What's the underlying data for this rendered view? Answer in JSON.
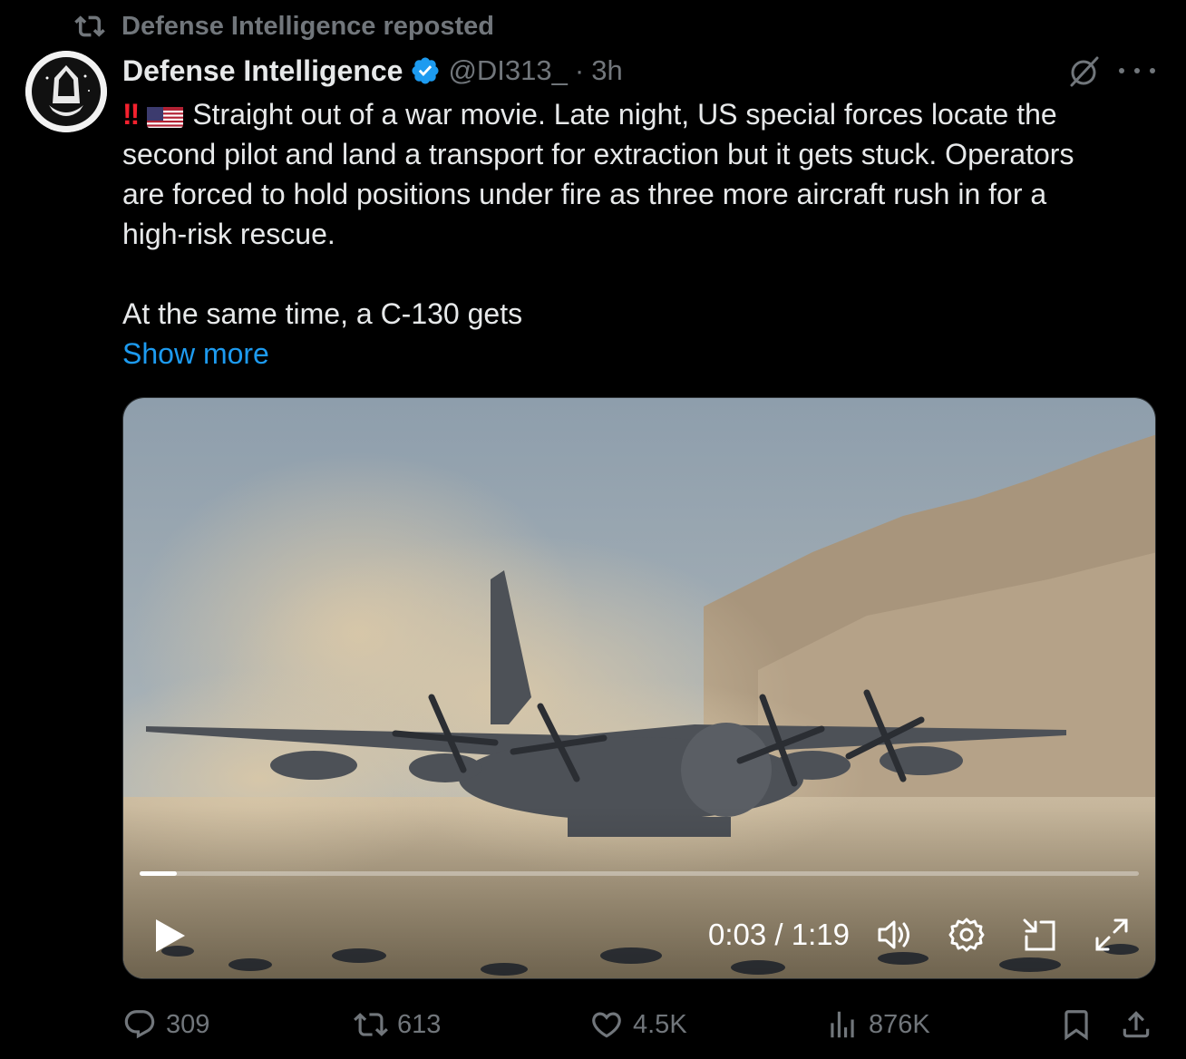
{
  "repost": {
    "text": "Defense Intelligence reposted"
  },
  "author": {
    "name": "Defense Intelligence",
    "handle": "@DI313_",
    "separator": "·",
    "time": "3h"
  },
  "post": {
    "lines": [
      "Straight out of a war movie. Late night, US special forces locate the",
      "second pilot and land a transport for extraction but it gets stuck. Operators",
      "are forced to hold positions under fire as three more aircraft rush in for a",
      "high-risk rescue."
    ],
    "prefix_emoji": "‼️",
    "line5": "At the same time, a C-130 gets",
    "show_more": "Show more"
  },
  "video": {
    "current_time": "0:03",
    "duration": "1:19",
    "time_display": "0:03 / 1:19",
    "progress_fraction": 0.037
  },
  "metrics": {
    "replies": "309",
    "reposts": "613",
    "likes": "4.5K",
    "views": "876K"
  },
  "icons": {
    "repost": "repost-icon",
    "verified": "verified-badge-icon",
    "grok": "grok-icon",
    "more": "more-icon",
    "play": "play-icon",
    "volume": "volume-icon",
    "settings": "gear-icon",
    "pip": "picture-in-picture-icon",
    "fullscreen": "fullscreen-icon",
    "reply": "reply-icon",
    "like": "heart-icon",
    "views": "views-icon",
    "bookmark": "bookmark-icon",
    "share": "share-icon"
  },
  "colors": {
    "background": "#000000",
    "text": "#e7e9ea",
    "muted": "#71767b",
    "link": "#1d9bf0",
    "verified": "#1d9bf0"
  }
}
